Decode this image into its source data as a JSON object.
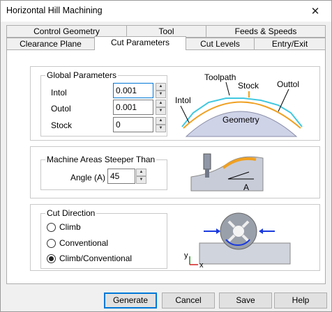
{
  "window": {
    "title": "Horizontal Hill Machining",
    "close_glyph": "✕"
  },
  "tabs_row1": [
    {
      "label": "Control Geometry"
    },
    {
      "label": "Tool"
    },
    {
      "label": "Feeds & Speeds"
    }
  ],
  "tabs_row2": [
    {
      "label": "Clearance Plane"
    },
    {
      "label": "Cut Parameters",
      "active": true
    },
    {
      "label": "Cut Levels"
    },
    {
      "label": "Entry/Exit"
    }
  ],
  "global": {
    "title": "Global Parameters",
    "intol_label": "Intol",
    "intol_value": "0.001",
    "outol_label": "Outol",
    "outol_value": "0.001",
    "stock_label": "Stock",
    "stock_value": "0",
    "diagram": {
      "toolpath": "Toolpath",
      "stock": "Stock",
      "intol": "Intol",
      "outol": "Outtol",
      "geometry": "Geometry"
    }
  },
  "steep": {
    "title": "Machine Areas Steeper Than",
    "angle_label": "Angle (A)",
    "angle_value": "45",
    "diagram_label": "A"
  },
  "cut": {
    "title": "Cut Direction",
    "options": [
      {
        "label": "Climb",
        "selected": false
      },
      {
        "label": "Conventional",
        "selected": false
      },
      {
        "label": "Climb/Conventional",
        "selected": true
      }
    ],
    "axis_y": "y",
    "axis_x": "x"
  },
  "buttons": {
    "generate": "Generate",
    "cancel": "Cancel",
    "save": "Save",
    "help": "Help"
  },
  "colors": {
    "accent": "#0078d7",
    "toolpath": "#40c8e0",
    "stock": "#f0a020"
  },
  "icons": {
    "spin_up": "▲",
    "spin_down": "▼"
  }
}
